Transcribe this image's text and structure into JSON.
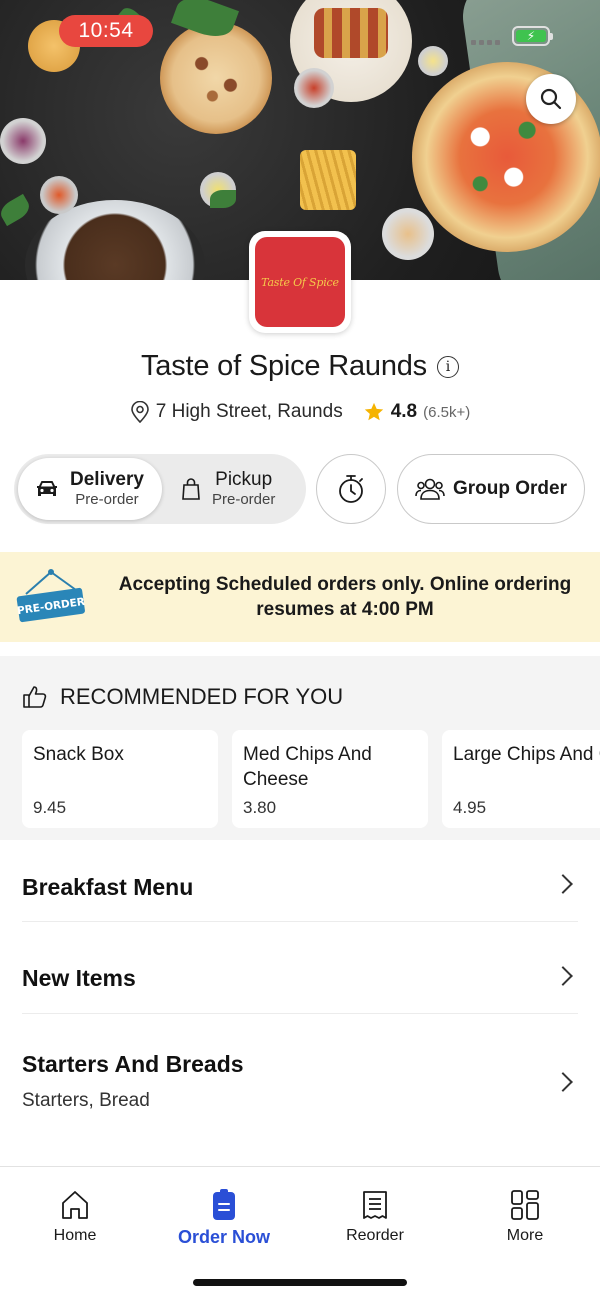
{
  "status_bar": {
    "time": "10:54",
    "battery_icon": "battery-charging-icon"
  },
  "colors": {
    "accent": "#2a4fd6",
    "banner_bg": "#fcf4d4",
    "time_pill": "#e8473f",
    "star": "#f5b301",
    "logo_bg": "#d8343a"
  },
  "restaurant": {
    "logo_text": "Taste Of Spice",
    "name": "Taste of Spice Raunds",
    "address": "7 High Street, Raunds",
    "rating": "4.8",
    "reviews": "(6.5k+)"
  },
  "order_mode": {
    "delivery": {
      "label": "Delivery",
      "sub": "Pre-order",
      "selected": true
    },
    "pickup": {
      "label": "Pickup",
      "sub": "Pre-order",
      "selected": false
    },
    "group_order_label": "Group Order"
  },
  "banner": {
    "sign_text": "PRE-ORDER",
    "message": "Accepting Scheduled orders only. Online ordering resumes at 4:00 PM"
  },
  "recommended": {
    "title": "RECOMMENDED FOR YOU",
    "items": [
      {
        "name": "Snack Box",
        "price": "9.45"
      },
      {
        "name": "Med Chips And Cheese",
        "price": "3.80"
      },
      {
        "name": "Large Chips And Cheese",
        "price": "4.95"
      }
    ]
  },
  "menu": [
    {
      "title": "Breakfast Menu",
      "subtitle": ""
    },
    {
      "title": "New Items",
      "subtitle": ""
    },
    {
      "title": "Starters And Breads",
      "subtitle": "Starters, Bread"
    }
  ],
  "bottom_nav": [
    {
      "label": "Home",
      "icon": "home-icon",
      "active": false
    },
    {
      "label": "Order Now",
      "icon": "order-now-icon",
      "active": true
    },
    {
      "label": "Reorder",
      "icon": "receipt-icon",
      "active": false
    },
    {
      "label": "More",
      "icon": "grid-icon",
      "active": false
    }
  ]
}
